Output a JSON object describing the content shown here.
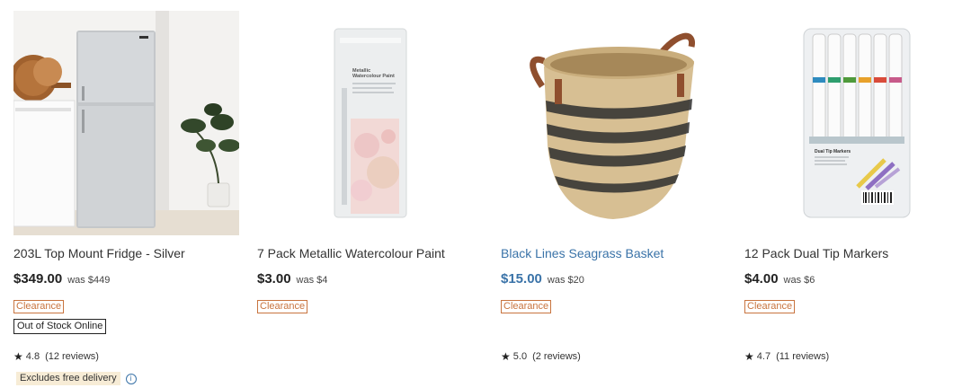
{
  "products": [
    {
      "name": "203L Top Mount Fridge - Silver",
      "price": "$349.00",
      "was": "was $449",
      "badge": "Clearance",
      "stock": "Out of Stock Online",
      "rating": "4.8",
      "reviews": "(12 reviews)",
      "delivery": "Excludes free delivery",
      "icon": "fridge-photo"
    },
    {
      "name": "7 Pack Metallic Watercolour Paint",
      "price": "$3.00",
      "was": "was $4",
      "badge": "Clearance",
      "icon": "watercolour-paint-pack",
      "pack_text": "Metallic Watercolour Paint"
    },
    {
      "name": "Black Lines Seagrass Basket",
      "price": "$15.00",
      "was": "was $20",
      "badge": "Clearance",
      "rating": "5.0",
      "reviews": "(2 reviews)",
      "icon": "seagrass-basket"
    },
    {
      "name": "12 Pack Dual Tip Markers",
      "price": "$4.00",
      "was": "was $6",
      "badge": "Clearance",
      "rating": "4.7",
      "reviews": "(11 reviews)",
      "icon": "dual-tip-markers-pack",
      "pack_text": "Dual Tip Markers"
    }
  ],
  "colors": {
    "link": "#3a73a8",
    "clearance": "#c8743f",
    "delivery_bg": "#f7ecd6"
  }
}
